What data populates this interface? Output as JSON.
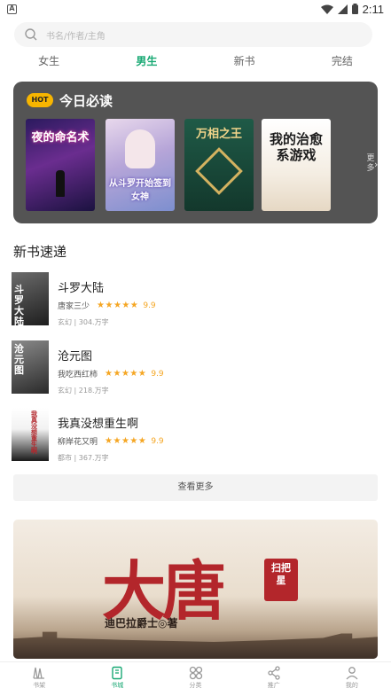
{
  "status_bar": {
    "time": "2:11"
  },
  "search": {
    "placeholder": "书名/作者/主角",
    "icon": "search-icon"
  },
  "tabs": [
    {
      "label": "女生",
      "active": false
    },
    {
      "label": "男生",
      "active": true
    },
    {
      "label": "新书",
      "active": false
    },
    {
      "label": "完结",
      "active": false
    }
  ],
  "must_read": {
    "badge": "HOT",
    "title": "今日必读",
    "more_label": "更多",
    "covers": [
      {
        "title": "夜的命名术"
      },
      {
        "title": "从斗罗开始签到女神"
      },
      {
        "title": "万相之王"
      },
      {
        "title": "我的治愈系游戏"
      }
    ]
  },
  "new_books": {
    "title": "新书速递",
    "items": [
      {
        "name": "斗罗大陆",
        "author": "唐家三少",
        "score": "9.9",
        "genre": "玄幻",
        "words": "304.万字",
        "cover_text": "斗罗大陆"
      },
      {
        "name": "沧元图",
        "author": "我吃西红柿",
        "score": "9.9",
        "genre": "玄幻",
        "words": "218.万字",
        "cover_text": "沧元图"
      },
      {
        "name": "我真没想重生啊",
        "author": "柳岸花又明",
        "score": "9.9",
        "genre": "都市",
        "words": "367.万字",
        "cover_text": "我真没想重生啊"
      }
    ],
    "see_more": "查看更多"
  },
  "banner": {
    "big_text": "大唐",
    "seal_text": "扫把星",
    "author_text": "迪巴拉爵士◎著"
  },
  "bottom_nav": [
    {
      "label": "书架",
      "icon": "bookshelf-icon",
      "active": false
    },
    {
      "label": "书城",
      "icon": "book-icon",
      "active": true
    },
    {
      "label": "分类",
      "icon": "category-icon",
      "active": false
    },
    {
      "label": "推广",
      "icon": "share-icon",
      "active": false
    },
    {
      "label": "我的",
      "icon": "profile-icon",
      "active": false
    }
  ],
  "colors": {
    "accent": "#19a974",
    "hot_badge": "#f7b500",
    "star": "#f5a623",
    "card_bg": "#545454"
  }
}
